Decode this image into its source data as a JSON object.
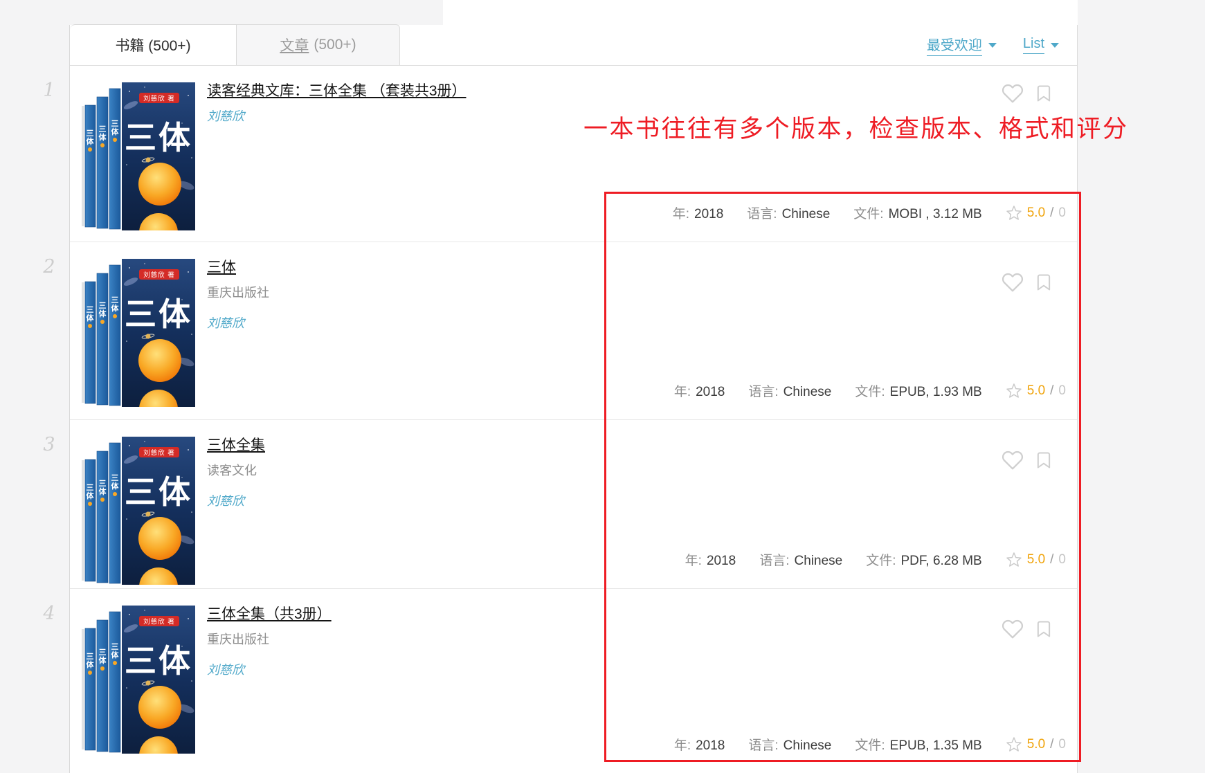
{
  "colors": {
    "accent": "#4fa8c9",
    "orange": "#f0a30a",
    "red": "#ee1c24"
  },
  "tabs": {
    "books": "书籍 (500+)",
    "articles_link": "文章",
    "articles_count": "(500+)"
  },
  "sort": {
    "popular": "最受欢迎",
    "view": "List"
  },
  "annotation": {
    "text": "一本书往往有多个版本，检查版本、格式和评分"
  },
  "cover": {
    "title": "三体",
    "author_label": "刘慈欣 著"
  },
  "results": {
    "labels": {
      "year": "年:",
      "language": "语言:",
      "file": "文件:",
      "slash": "/"
    },
    "items": [
      {
        "index": "1",
        "title": "读客经典文库：三体全集 （套装共3册）",
        "publisher": "",
        "author": "刘慈欣",
        "year": "2018",
        "language": "Chinese",
        "file": "MOBI , 3.12 MB",
        "rating": "5.0",
        "rating_count": "0"
      },
      {
        "index": "2",
        "title": "三体",
        "publisher": "重庆出版社",
        "author": "刘慈欣",
        "year": "2018",
        "language": "Chinese",
        "file": "EPUB, 1.93 MB",
        "rating": "5.0",
        "rating_count": "0"
      },
      {
        "index": "3",
        "title": "三体全集",
        "publisher": "读客文化",
        "author": "刘慈欣",
        "year": "2018",
        "language": "Chinese",
        "file": "PDF, 6.28 MB",
        "rating": "5.0",
        "rating_count": "0"
      },
      {
        "index": "4",
        "title": "三体全集（共3册）",
        "publisher": "重庆出版社",
        "author": "刘慈欣",
        "year": "2018",
        "language": "Chinese",
        "file": "EPUB, 1.35 MB",
        "rating": "5.0",
        "rating_count": "0"
      }
    ]
  }
}
